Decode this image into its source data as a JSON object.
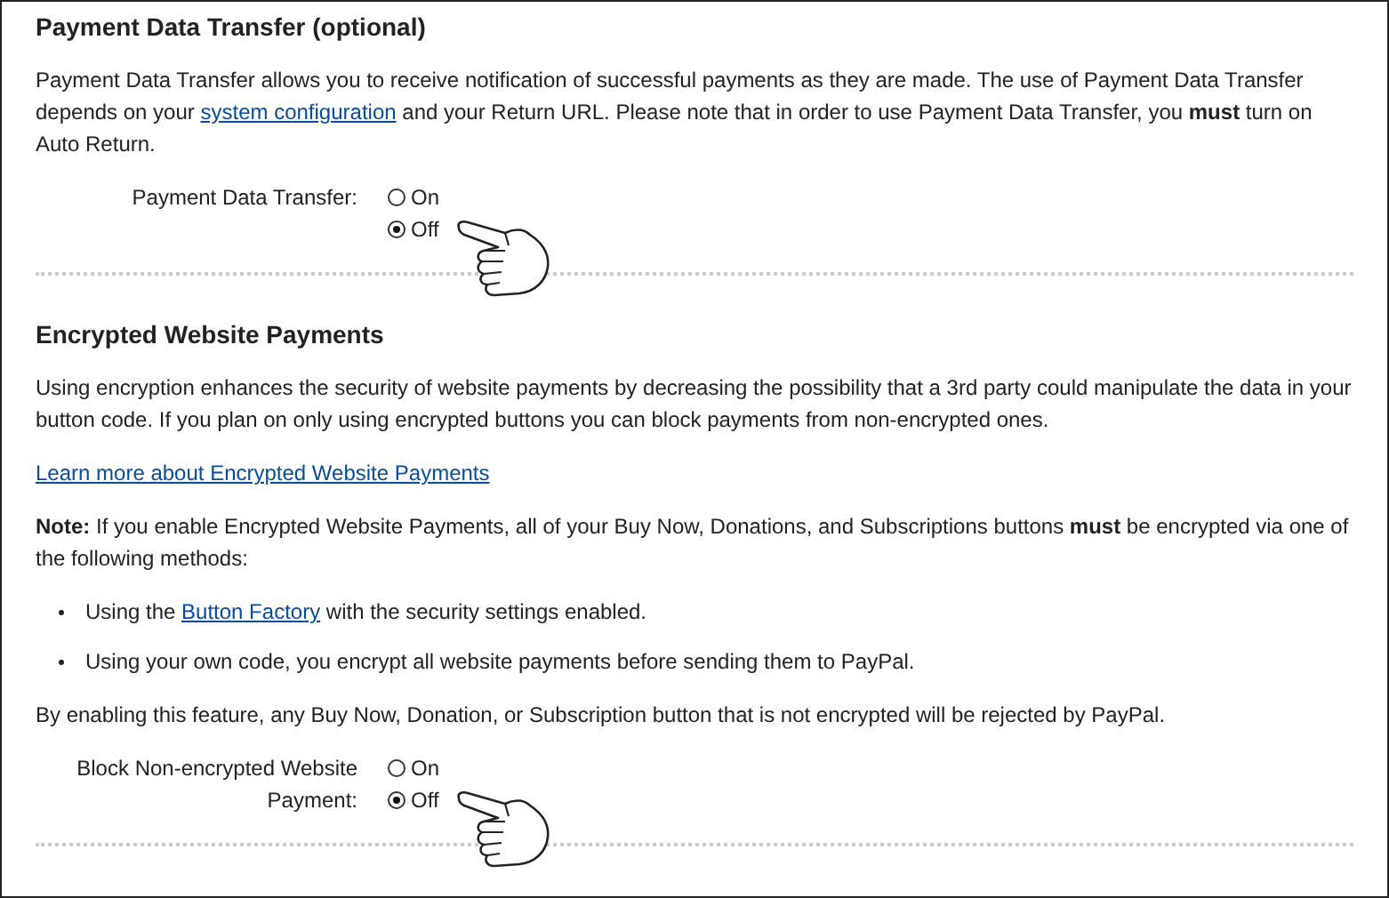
{
  "sections": [
    {
      "title": "Payment Data Transfer (optional)",
      "blocks": [
        {
          "kind": "paragraph",
          "parts": [
            {
              "kind": "text",
              "text": "Payment Data Transfer allows you to receive notification of successful payments as they are made. The use of Payment Data Transfer depends on your "
            },
            {
              "kind": "link",
              "text": "system configuration"
            },
            {
              "kind": "text",
              "text": " and your Return URL. Please note that in order to use Payment Data Transfer, you **must** turn on Auto Return."
            }
          ]
        }
      ],
      "setting": {
        "label": "Payment Data Transfer:",
        "options": [
          {
            "label": "On",
            "selected": false
          },
          {
            "label": "Off",
            "selected": true
          }
        ]
      }
    },
    {
      "title": "Encrypted Website Payments",
      "blocks": [
        {
          "kind": "paragraph",
          "parts": [
            {
              "kind": "text",
              "text": "Using encryption enhances the security of website payments by decreasing the possibility that a 3rd party could manipulate the data in your button code. If you plan on only using encrypted buttons you can block payments from non-encrypted ones."
            }
          ]
        },
        {
          "kind": "paragraph",
          "parts": [
            {
              "kind": "link",
              "text": "Learn more about Encrypted Website Payments"
            }
          ]
        },
        {
          "kind": "paragraph",
          "parts": [
            {
              "kind": "text",
              "text": "**Note:** If you enable Encrypted Website Payments, all of your Buy Now, Donations, and Subscriptions buttons **must** be encrypted via one of the following methods:"
            }
          ]
        },
        {
          "kind": "list",
          "items": [
            [
              {
                "kind": "text",
                "text": "Using the "
              },
              {
                "kind": "link",
                "text": "Button Factory"
              },
              {
                "kind": "text",
                "text": " with the security settings enabled."
              }
            ],
            [
              {
                "kind": "text",
                "text": "Using your own code, you encrypt all website payments before sending them to PayPal."
              }
            ]
          ]
        },
        {
          "kind": "paragraph",
          "parts": [
            {
              "kind": "text",
              "text": "By enabling this feature, any Buy Now, Donation, or Subscription button that is not encrypted will be rejected by PayPal."
            }
          ]
        }
      ],
      "setting": {
        "label": "Block Non-encrypted Website Payment:",
        "options": [
          {
            "label": "On",
            "selected": false
          },
          {
            "label": "Off",
            "selected": true
          }
        ]
      }
    }
  ]
}
